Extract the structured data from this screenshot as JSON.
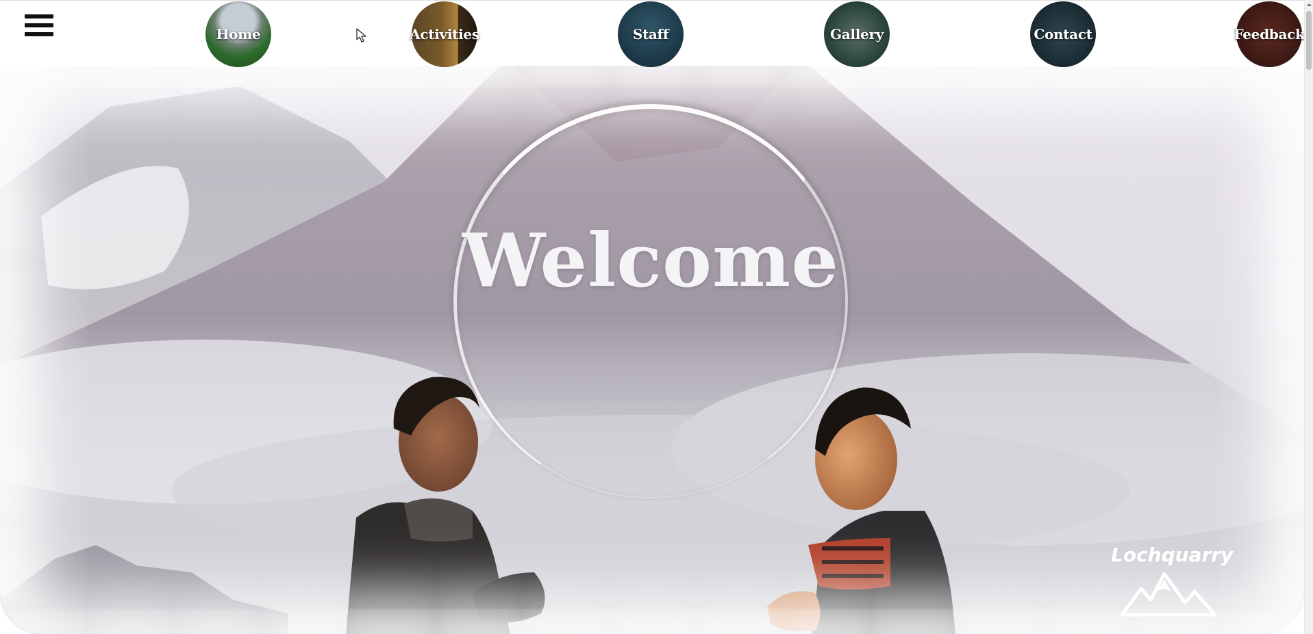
{
  "nav": {
    "menu_icon": "hamburger-menu-icon",
    "items": [
      {
        "label": "Home"
      },
      {
        "label": "Activities"
      },
      {
        "label": "Staff"
      },
      {
        "label": "Gallery"
      },
      {
        "label": "Contact"
      },
      {
        "label": "Feedback"
      }
    ]
  },
  "hero": {
    "title": "Welcome",
    "background": "misty mountain with two smiling people"
  },
  "logo": {
    "text": "Lochquarry",
    "icon": "mountain-logo-icon"
  },
  "colors": {
    "page_background": "#ffffff",
    "title_text": "#f4f3f5",
    "menu_icon": "#111111"
  }
}
